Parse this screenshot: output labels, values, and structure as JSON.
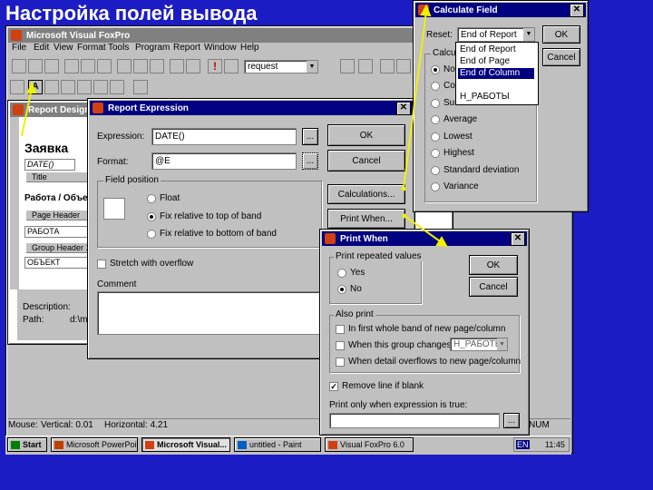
{
  "slide": {
    "title": "Настройка полей вывода"
  },
  "vfp": {
    "title": "Microsoft Visual FoxPro",
    "menu": [
      "File",
      "Edit",
      "View",
      "Format",
      "Tools",
      "Program",
      "Report",
      "Window",
      "Help"
    ],
    "toolbar_combo": "request",
    "status_bar": {
      "mode": "Mouse:",
      "vertical": "Vertical:  0.01",
      "horizontal": "Horizontal:  4.21",
      "num": "NUM"
    }
  },
  "report_designer": {
    "title": "Report Designer",
    "labels": {
      "title_text": "Заявка",
      "date_field": "DATE()",
      "rabota_label": "Работа / Объект",
      "rabota_field": "РАБОТА",
      "obekt_field": "ОБЪЕКТ"
    },
    "bands": [
      "Title",
      "Page Header",
      "Group Header 1"
    ],
    "description_label": "Description:",
    "path_label": "Path:",
    "path_value": "d:\\my"
  },
  "report_expression": {
    "title": "Report Expression",
    "expression_label": "Expression:",
    "expression_value": "DATE()",
    "format_label": "Format:",
    "format_value": "@E",
    "ellipsis": "...",
    "ok": "OK",
    "cancel": "Cancel",
    "calculations": "Calculations...",
    "print_when": "Print When...",
    "field_position": {
      "title": "Field position",
      "options": [
        "Float",
        "Fix relative to top of band",
        "Fix relative to bottom of band"
      ],
      "selected_index": 1
    },
    "stretch": "Stretch with overflow",
    "comment_label": "Comment"
  },
  "calculate_field": {
    "title": "Calculate Field",
    "reset_label": "Reset:",
    "reset_value": "End of Report",
    "ok": "OK",
    "cancel": "Cancel",
    "calculate_label": "Calculate",
    "dropdown_options": [
      "End of Report",
      "End of Page",
      "End of Column",
      "Н_РАБОТЫ"
    ],
    "dropdown_selected_index": 2,
    "options": [
      "Nothing",
      "Count",
      "Sum",
      "Average",
      "Lowest",
      "Highest",
      "Standard deviation",
      "Variance"
    ],
    "visible_labels": [
      "Noth",
      "Cou",
      "Sum",
      "Average",
      "Lowest",
      "Highest",
      "Standard deviation",
      "Variance"
    ],
    "selected_index": 0
  },
  "print_when": {
    "title": "Print When",
    "repeated_title": "Print repeated values",
    "yes": "Yes",
    "no": "No",
    "repeated_selected": "No",
    "also_print_title": "Also print",
    "also_print_options": [
      "In first whole band of new page/column",
      "When this group changes",
      "When detail overflows to new page/column"
    ],
    "group_combo": "Н_РАБОТЫ",
    "remove_line": "Remove line if blank",
    "remove_line_checked": true,
    "expression_label": "Print only when expression is true:",
    "ellipsis": "...",
    "ok": "OK",
    "cancel": "Cancel"
  },
  "taskbar": {
    "start": "Start",
    "items": [
      "Microsoft PowerPoi...",
      "Microsoft Visual...",
      "untitled - Paint",
      "Visual FoxPro 6.0"
    ],
    "tray_lang": "EN",
    "clock": "11:45"
  },
  "colors": {
    "desktop": "#1c1cc4",
    "titlebar": "#000080",
    "arrow": "#f0f000",
    "face": "#c0c0c0"
  }
}
